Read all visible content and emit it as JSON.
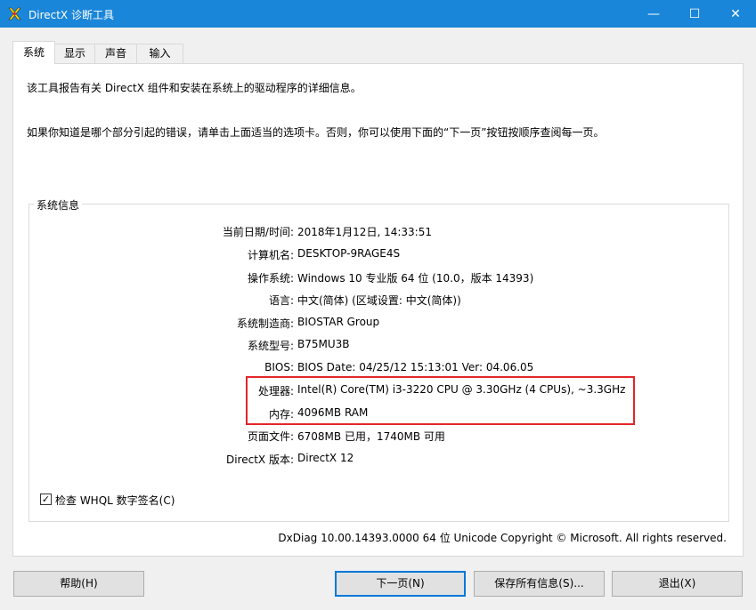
{
  "window": {
    "title": "DirectX 诊断工具",
    "minimize_glyph": "—",
    "maximize_glyph": "☐",
    "close_glyph": "✕",
    "titlebar_color": "#1a86d9"
  },
  "tabs": [
    {
      "label": "系统",
      "active": true
    },
    {
      "label": "显示",
      "active": false
    },
    {
      "label": "声音",
      "active": false
    },
    {
      "label": "输入",
      "active": false
    }
  ],
  "intro": {
    "line1": "该工具报告有关 DirectX 组件和安装在系统上的驱动程序的详细信息。",
    "line2": "如果你知道是哪个部分引起的错误，请单击上面适当的选项卡。否则，你可以使用下面的“下一页”按钮按顺序查阅每一页。"
  },
  "system_info": {
    "legend": "系统信息",
    "rows": [
      {
        "label": "当前日期/时间:",
        "value": "2018年1月12日, 14:33:51"
      },
      {
        "label": "计算机名:",
        "value": "DESKTOP-9RAGE4S"
      },
      {
        "label": "操作系统:",
        "value": "Windows 10 专业版 64 位 (10.0，版本 14393)"
      },
      {
        "label": "语言:",
        "value": "中文(简体) (区域设置: 中文(简体))"
      },
      {
        "label": "系统制造商:",
        "value": "BIOSTAR Group"
      },
      {
        "label": "系统型号:",
        "value": "B75MU3B"
      },
      {
        "label": "BIOS:",
        "value": "BIOS Date: 04/25/12 15:13:01 Ver: 04.06.05"
      },
      {
        "label": "处理器:",
        "value": "Intel(R) Core(TM) i3-3220 CPU @ 3.30GHz (4 CPUs), ~3.3GHz"
      },
      {
        "label": "内存:",
        "value": "4096MB RAM"
      },
      {
        "label": "页面文件:",
        "value": "6708MB 已用，1740MB 可用"
      },
      {
        "label": "DirectX 版本:",
        "value": "DirectX 12"
      }
    ],
    "whql_checkbox_label": "检查 WHQL 数字签名(C)",
    "whql_checked": true,
    "check_glyph": "✓",
    "highlight_color": "#e2262a"
  },
  "footer": {
    "version_text": "DxDiag 10.00.14393.0000 64 位 Unicode  Copyright © Microsoft. All rights reserved."
  },
  "buttons": {
    "help": "帮助(H)",
    "next": "下一页(N)",
    "save": "保存所有信息(S)...",
    "exit": "退出(X)"
  }
}
